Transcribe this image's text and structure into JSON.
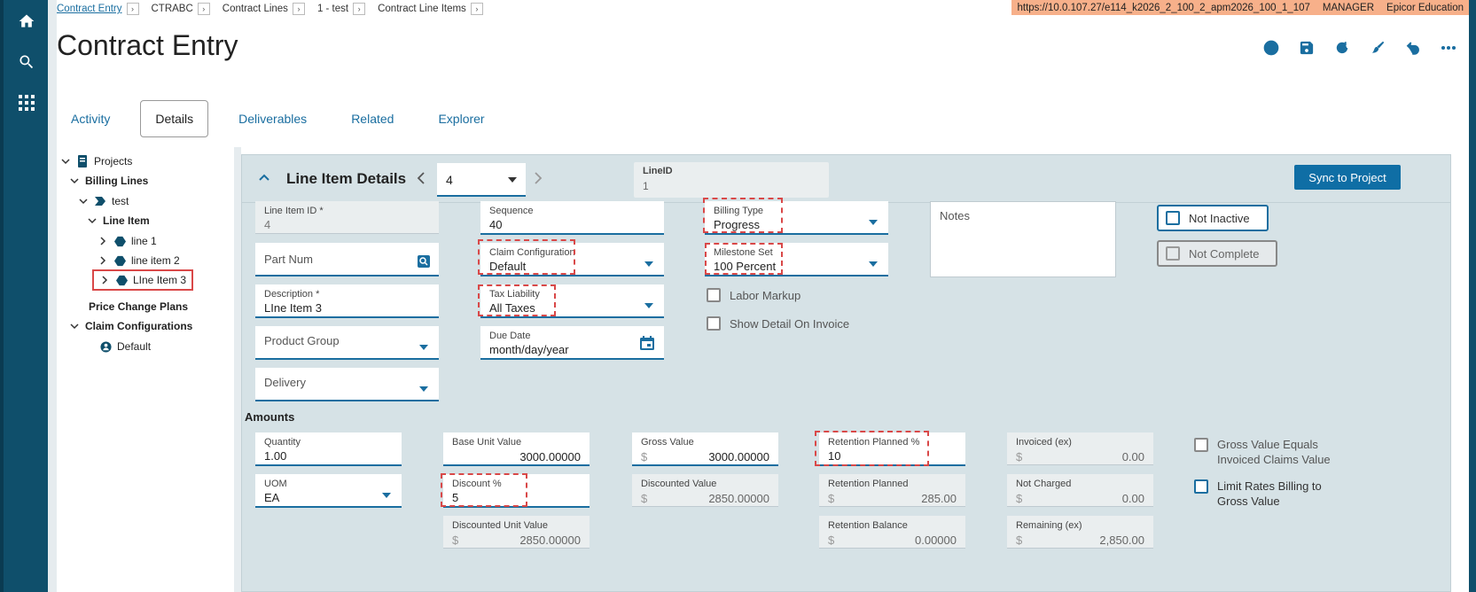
{
  "breadcrumb": [
    "Contract Entry",
    "CTRABC",
    "Contract Lines",
    "1 - test",
    "Contract Line Items"
  ],
  "env": {
    "url": "https://10.0.107.27/e114_k2026_2_100_2_apm2026_100_1_107",
    "user": "MANAGER",
    "company": "Epicor Education"
  },
  "page_title": "Contract Entry",
  "tabs": [
    "Activity",
    "Details",
    "Deliverables",
    "Related",
    "Explorer"
  ],
  "tree": {
    "projects": "Projects",
    "billing_lines": "Billing Lines",
    "test": "test",
    "line_item": "Line Item",
    "line1": "line 1",
    "line2": "line item 2",
    "line3": "LIne Item 3",
    "price_change": "Price Change Plans",
    "claim_configs": "Claim Configurations",
    "default": "Default"
  },
  "panel": {
    "title": "Line Item Details",
    "selector": "4",
    "lineid_label": "LineID",
    "lineid_value": "1",
    "sync_label": "Sync to Project"
  },
  "fields": {
    "line_item_id": {
      "label": "Line Item ID *",
      "value": "4"
    },
    "part_num": {
      "label": "Part Num"
    },
    "description": {
      "label": "Description *",
      "value": "LIne Item 3"
    },
    "product_group": {
      "label": "Product Group"
    },
    "delivery": {
      "label": "Delivery"
    },
    "sequence": {
      "label": "Sequence",
      "value": "40"
    },
    "claim_config": {
      "label": "Claim Configuration",
      "value": "Default"
    },
    "tax_liability": {
      "label": "Tax Liability",
      "value": "All Taxes"
    },
    "due_date": {
      "label": "Due Date",
      "value": "month/day/year"
    },
    "billing_type": {
      "label": "Billing Type",
      "value": "Progress"
    },
    "milestone_set": {
      "label": "Milestone Set",
      "value": "100 Percent"
    },
    "labor_markup": "Labor Markup",
    "show_detail": "Show Detail On Invoice",
    "notes": "Notes",
    "not_inactive": "Not Inactive",
    "not_complete": "Not Complete"
  },
  "amounts": {
    "title": "Amounts",
    "currency": "$",
    "quantity": {
      "label": "Quantity",
      "value": "1.00"
    },
    "uom": {
      "label": "UOM",
      "value": "EA"
    },
    "base_unit": {
      "label": "Base Unit Value",
      "value": "3000.00000"
    },
    "discount_pct": {
      "label": "Discount %",
      "value": "5"
    },
    "discounted_unit": {
      "label": "Discounted Unit Value",
      "value": "2850.00000"
    },
    "gross_value": {
      "label": "Gross Value",
      "value": "3000.00000"
    },
    "discounted_value": {
      "label": "Discounted Value",
      "value": "2850.00000"
    },
    "retention_pct": {
      "label": "Retention Planned %",
      "value": "10"
    },
    "retention_planned": {
      "label": "Retention Planned",
      "value": "285.00"
    },
    "retention_balance": {
      "label": "Retention Balance",
      "value": "0.00000"
    },
    "invoiced": {
      "label": "Invoiced (ex)",
      "value": "0.00"
    },
    "not_charged": {
      "label": "Not Charged",
      "value": "0.00"
    },
    "remaining": {
      "label": "Remaining (ex)",
      "value": "2,850.00"
    },
    "gross_equals": "Gross Value Equals Invoiced Claims Value",
    "limit_rates": "Limit Rates Billing to Gross Value"
  }
}
